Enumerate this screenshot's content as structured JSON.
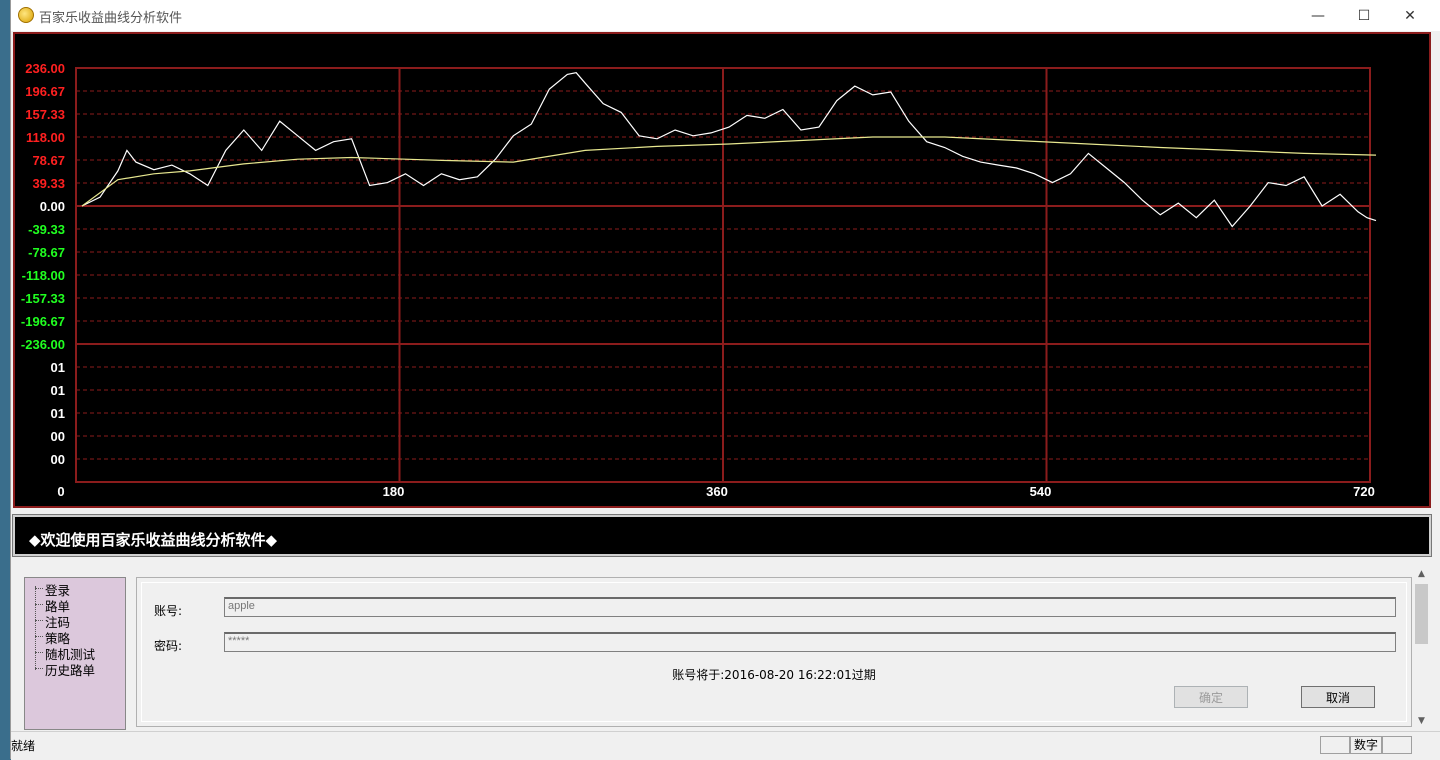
{
  "window": {
    "title": "百家乐收益曲线分析软件",
    "controls": {
      "minimize": "—",
      "maximize": "☐",
      "close": "✕"
    }
  },
  "chart_data": {
    "type": "line",
    "y_ticks_upper": [
      "236.00",
      "196.67",
      "157.33",
      "118.00",
      "78.67",
      "39.33",
      "0.00",
      "-39.33",
      "-78.67",
      "-118.00",
      "-157.33",
      "-196.67",
      "-236.00"
    ],
    "y_ticks_lower": [
      "01",
      "01",
      "01",
      "00",
      "00"
    ],
    "x_ticks": [
      "0",
      "180",
      "360",
      "540",
      "720"
    ],
    "xlim": [
      0,
      720
    ],
    "ylim": [
      -236,
      236
    ],
    "grid": true,
    "colors": {
      "positive_labels": "#ff2020",
      "negative_labels": "#20ff20",
      "grid": "#8b1c1c",
      "profit_line": "#ffffff",
      "average_line": "#e8e890"
    },
    "series": [
      {
        "color": "#ffffff",
        "x": [
          0,
          10,
          20,
          25,
          30,
          40,
          50,
          60,
          70,
          80,
          90,
          100,
          110,
          120,
          130,
          140,
          150,
          160,
          170,
          180,
          190,
          200,
          210,
          220,
          230,
          240,
          250,
          260,
          270,
          275,
          280,
          290,
          300,
          310,
          320,
          330,
          340,
          350,
          360,
          370,
          380,
          390,
          400,
          410,
          420,
          430,
          440,
          450,
          460,
          470,
          480,
          490,
          500,
          510,
          520,
          530,
          540,
          550,
          560,
          570,
          580,
          590,
          600,
          610,
          620,
          630,
          640,
          650,
          660,
          670,
          680,
          690,
          700,
          710,
          715,
          720
        ],
        "y": [
          0,
          15,
          60,
          95,
          75,
          62,
          70,
          55,
          35,
          95,
          130,
          95,
          145,
          120,
          95,
          110,
          115,
          35,
          40,
          55,
          35,
          55,
          45,
          50,
          80,
          120,
          140,
          200,
          225,
          228,
          210,
          175,
          160,
          120,
          115,
          130,
          120,
          125,
          135,
          155,
          150,
          165,
          130,
          135,
          180,
          205,
          190,
          195,
          145,
          110,
          100,
          85,
          75,
          70,
          65,
          55,
          40,
          55,
          90,
          65,
          40,
          10,
          -15,
          5,
          -20,
          10,
          -35,
          0,
          40,
          35,
          50,
          0,
          20,
          -10,
          -20,
          -25
        ]
      },
      {
        "color": "#e8e890",
        "x": [
          0,
          20,
          40,
          60,
          90,
          120,
          150,
          180,
          200,
          240,
          280,
          320,
          360,
          400,
          440,
          480,
          520,
          560,
          600,
          640,
          680,
          720
        ],
        "y": [
          0,
          45,
          55,
          60,
          72,
          80,
          83,
          80,
          78,
          75,
          95,
          102,
          106,
          112,
          118,
          118,
          112,
          106,
          100,
          95,
          90,
          87
        ]
      }
    ]
  },
  "message": "◆欢迎使用百家乐收益曲线分析软件◆",
  "tree": {
    "items": [
      "登录",
      "路单",
      "注码",
      "策略",
      "随机测试",
      "历史路单"
    ]
  },
  "login": {
    "account_label": "账号:",
    "account_value": "apple",
    "password_label": "密码:",
    "password_value": "*****",
    "expire_text": "账号将于:2016-08-20 16:22:01过期",
    "ok_label": "确定",
    "cancel_label": "取消"
  },
  "status": {
    "left": "就绪",
    "mode": "数字"
  }
}
